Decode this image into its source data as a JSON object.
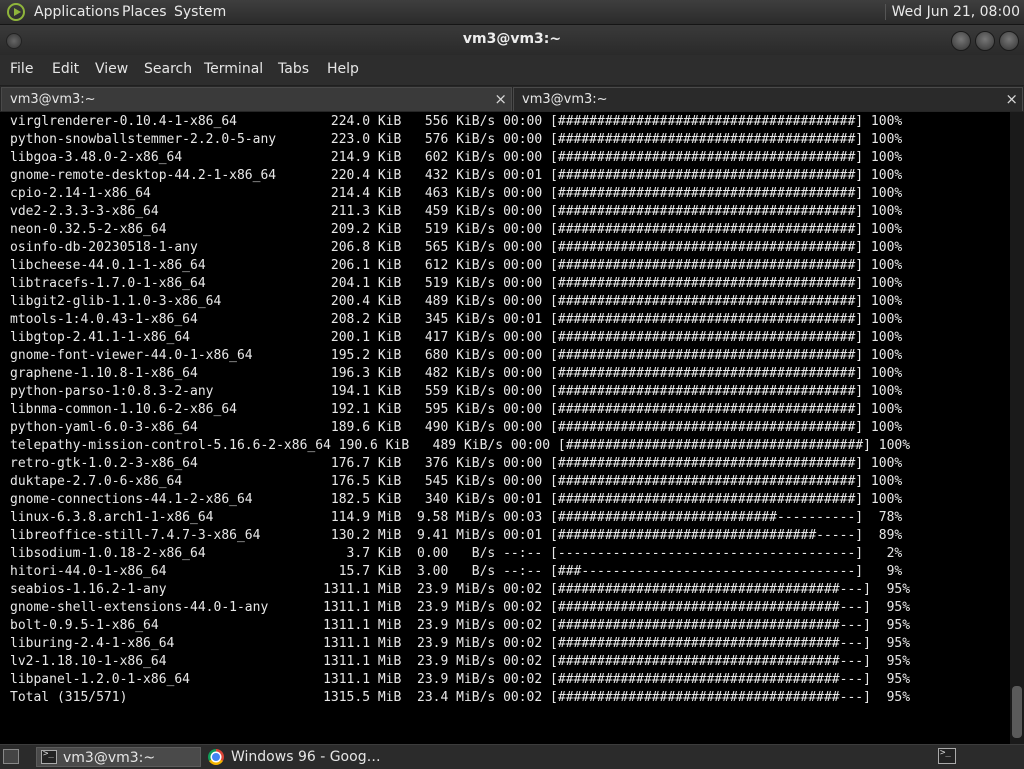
{
  "top_panel": {
    "menus": [
      "Applications",
      "Places",
      "System"
    ],
    "clock": "Wed Jun 21, 08:00"
  },
  "window": {
    "title": "vm3@vm3:~"
  },
  "menubar": [
    "File",
    "Edit",
    "View",
    "Search",
    "Terminal",
    "Tabs",
    "Help"
  ],
  "tabs": [
    {
      "label": "vm3@vm3:~",
      "close": "×"
    },
    {
      "label": "vm3@vm3:~",
      "close": "×"
    }
  ],
  "terminal": {
    "lines": [
      "virglrenderer-0.10.4-1-x86_64            224.0 KiB   556 KiB/s 00:00 [######################################] 100%",
      "python-snowballstemmer-2.2.0-5-any       223.0 KiB   576 KiB/s 00:00 [######################################] 100%",
      "libgoa-3.48.0-2-x86_64                   214.9 KiB   602 KiB/s 00:00 [######################################] 100%",
      "gnome-remote-desktop-44.2-1-x86_64       220.4 KiB   432 KiB/s 00:01 [######################################] 100%",
      "cpio-2.14-1-x86_64                       214.4 KiB   463 KiB/s 00:00 [######################################] 100%",
      "vde2-2.3.3-3-x86_64                      211.3 KiB   459 KiB/s 00:00 [######################################] 100%",
      "neon-0.32.5-2-x86_64                     209.2 KiB   519 KiB/s 00:00 [######################################] 100%",
      "osinfo-db-20230518-1-any                 206.8 KiB   565 KiB/s 00:00 [######################################] 100%",
      "libcheese-44.0.1-1-x86_64                206.1 KiB   612 KiB/s 00:00 [######################################] 100%",
      "libtracefs-1.7.0-1-x86_64                204.1 KiB   519 KiB/s 00:00 [######################################] 100%",
      "libgit2-glib-1.1.0-3-x86_64              200.4 KiB   489 KiB/s 00:00 [######################################] 100%",
      "mtools-1:4.0.43-1-x86_64                 208.2 KiB   345 KiB/s 00:01 [######################################] 100%",
      "libgtop-2.41.1-1-x86_64                  200.1 KiB   417 KiB/s 00:00 [######################################] 100%",
      "gnome-font-viewer-44.0-1-x86_64          195.2 KiB   680 KiB/s 00:00 [######################################] 100%",
      "graphene-1.10.8-1-x86_64                 196.3 KiB   482 KiB/s 00:00 [######################################] 100%",
      "python-parso-1:0.8.3-2-any               194.1 KiB   559 KiB/s 00:00 [######################################] 100%",
      "libnma-common-1.10.6-2-x86_64            192.1 KiB   595 KiB/s 00:00 [######################################] 100%",
      "python-yaml-6.0-3-x86_64                 189.6 KiB   490 KiB/s 00:00 [######################################] 100%",
      "telepathy-mission-control-5.16.6-2-x86_64 190.6 KiB   489 KiB/s 00:00 [######################################] 100%",
      "retro-gtk-1.0.2-3-x86_64                 176.7 KiB   376 KiB/s 00:00 [######################################] 100%",
      "duktape-2.7.0-6-x86_64                   176.5 KiB   545 KiB/s 00:00 [######################################] 100%",
      "gnome-connections-44.1-2-x86_64          182.5 KiB   340 KiB/s 00:01 [######################################] 100%",
      "linux-6.3.8.arch1-1-x86_64               114.9 MiB  9.58 MiB/s 00:03 [############################----------]  78%",
      "libreoffice-still-7.4.7-3-x86_64         130.2 MiB  9.41 MiB/s 00:01 [#################################-----]  89%",
      "libsodium-1.0.18-2-x86_64                  3.7 KiB  0.00   B/s --:-- [--------------------------------------]   2%",
      "hitori-44.0-1-x86_64                      15.7 KiB  3.00   B/s --:-- [###-----------------------------------]   9%",
      "seabios-1.16.2-1-any                    1311.1 MiB  23.9 MiB/s 00:02 [####################################---]  95%",
      "gnome-shell-extensions-44.0-1-any       1311.1 MiB  23.9 MiB/s 00:02 [####################################---]  95%",
      "bolt-0.9.5-1-x86_64                     1311.1 MiB  23.9 MiB/s 00:02 [####################################---]  95%",
      "liburing-2.4-1-x86_64                   1311.1 MiB  23.9 MiB/s 00:02 [####################################---]  95%",
      "lv2-1.18.10-1-x86_64                    1311.1 MiB  23.9 MiB/s 00:02 [####################################---]  95%",
      "libpanel-1.2.0-1-x86_64                 1311.1 MiB  23.9 MiB/s 00:02 [####################################---]  95%",
      "Total (315/571)                         1315.5 MiB  23.4 MiB/s 00:02 [####################################---]  95%"
    ]
  },
  "taskbar": {
    "tasks": [
      {
        "label": "vm3@vm3:~",
        "icon": "terminal-icon"
      },
      {
        "label": "Windows 96 - Goog…",
        "icon": "chrome-icon"
      }
    ]
  }
}
